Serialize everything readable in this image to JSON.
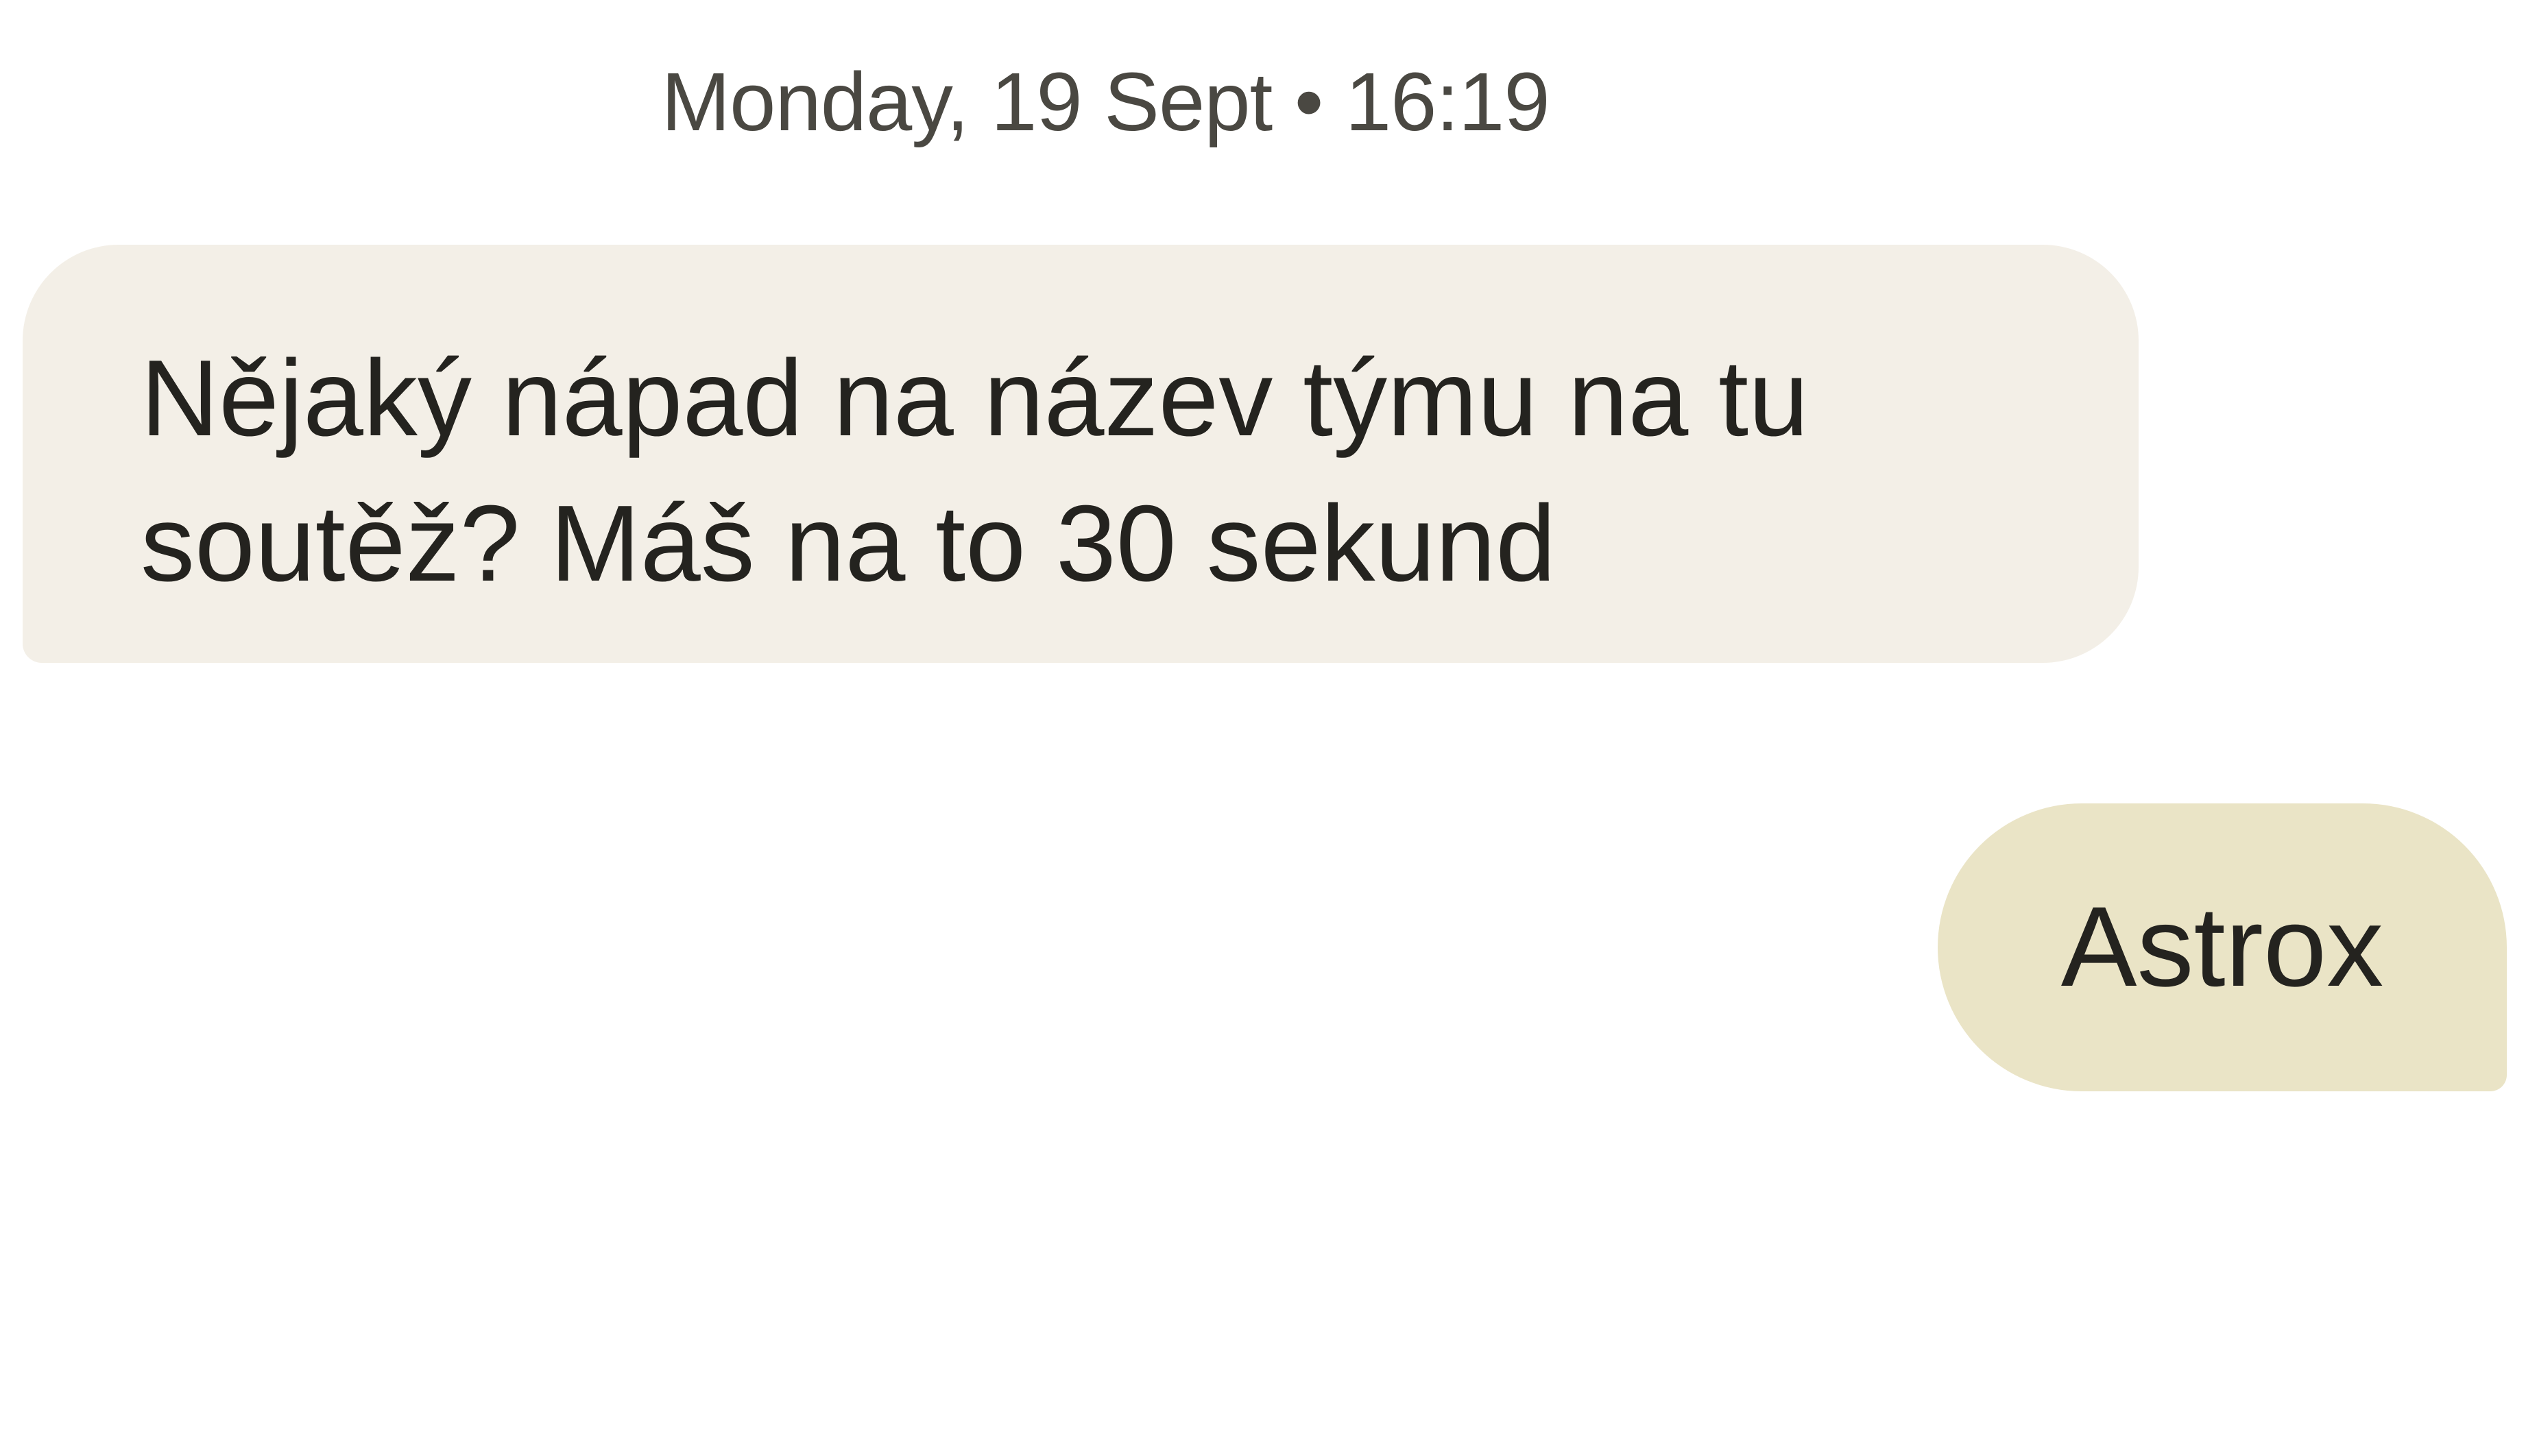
{
  "conversation": {
    "timestamp": "Monday, 19 Sept • 16:19",
    "messages": [
      {
        "direction": "incoming",
        "text": "Nějaký nápad na název týmu na tu\nsoutěž? Máš na to 30 sekund"
      },
      {
        "direction": "outgoing",
        "text": "Astrox"
      }
    ]
  },
  "colors": {
    "incoming_bubble": "#f3efe7",
    "outgoing_bubble": "#eae4c6",
    "text": "#24231f",
    "timestamp": "#4a4842",
    "background": "#ffffff"
  }
}
